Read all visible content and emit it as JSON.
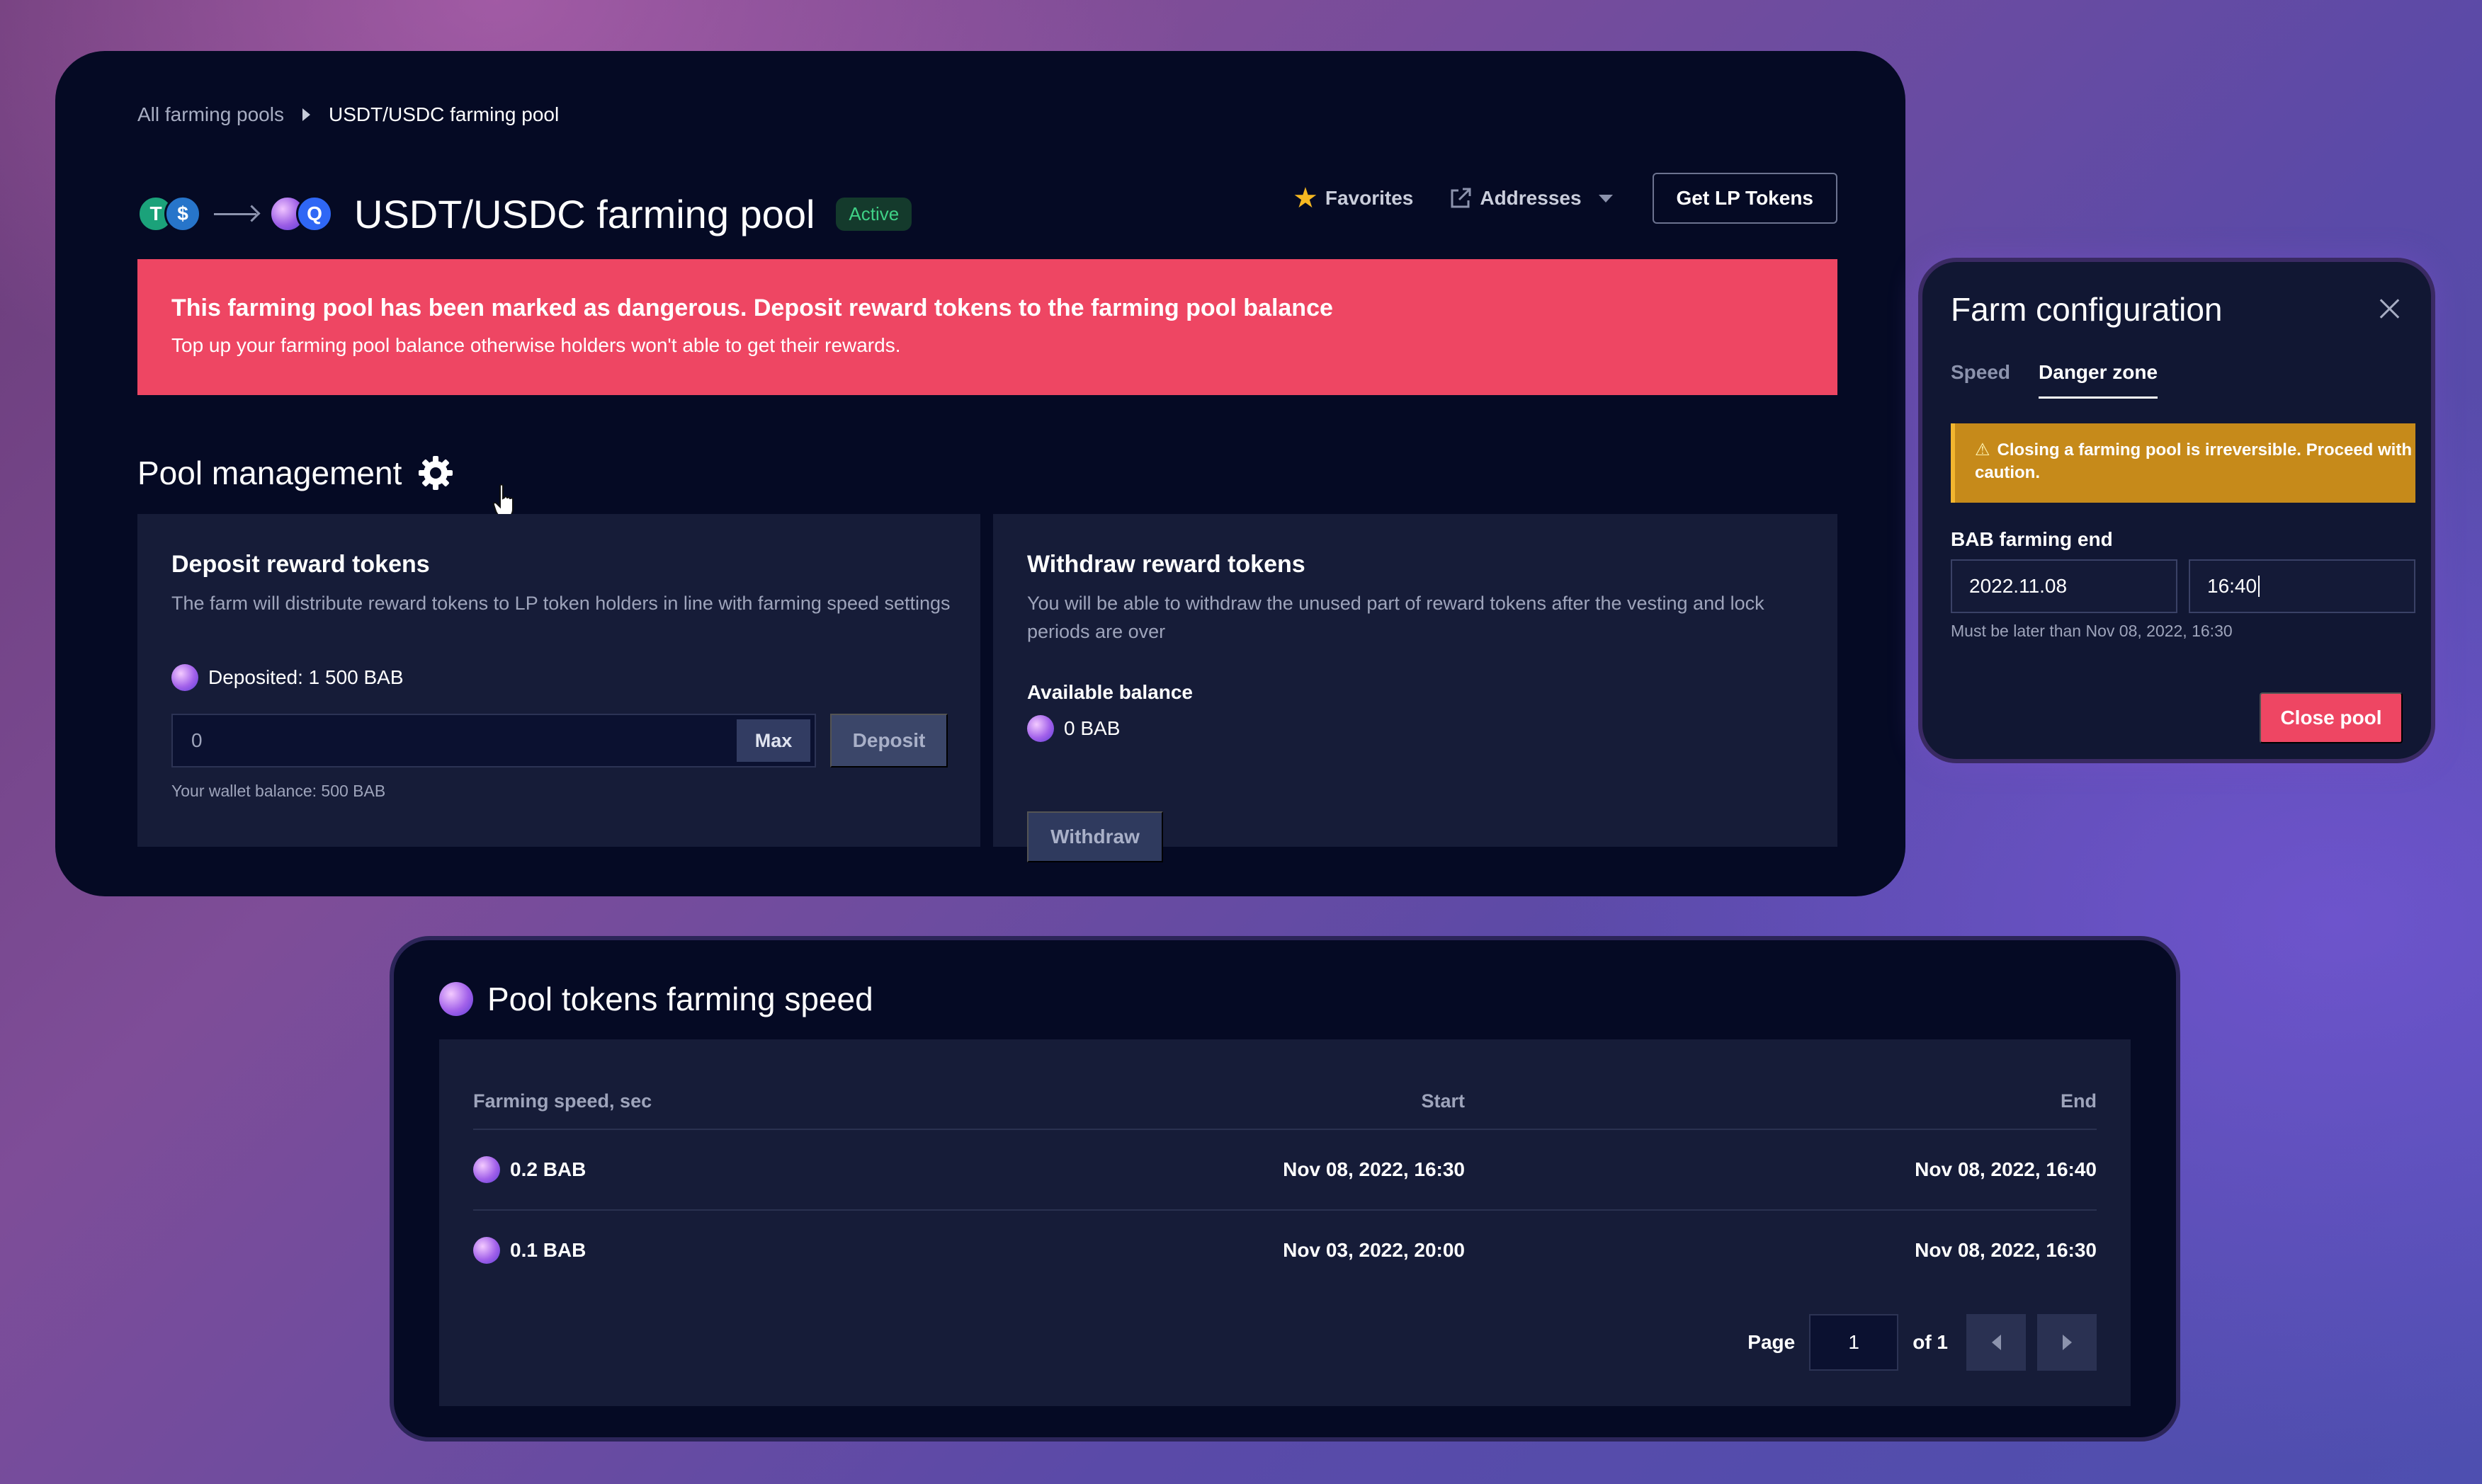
{
  "breadcrumb": {
    "parent": "All farming pools",
    "current": "USDT/USDC farming pool"
  },
  "header": {
    "token_a_icon": "usdt-icon",
    "token_b_icon": "usdc-icon",
    "title": "USDT/USDC farming pool",
    "status": "Active",
    "favorites_label": "Favorites",
    "addresses_label": "Addresses",
    "get_lp_label": "Get LP Tokens"
  },
  "alert": {
    "title": "This farming pool has been marked as dangerous. Deposit reward tokens to the farming pool balance",
    "subtitle": "Top up your farming pool balance otherwise holders won't able to get their rewards."
  },
  "management": {
    "title": "Pool management",
    "deposit": {
      "title": "Deposit reward tokens",
      "description": "The farm will distribute reward tokens to LP token holders in line with farming speed settings",
      "deposited": "Deposited: 1 500 BAB",
      "input_value": "0",
      "max_label": "Max",
      "deposit_label": "Deposit",
      "wallet_balance": "Your wallet balance: 500 BAB"
    },
    "withdraw": {
      "title": "Withdraw reward tokens",
      "description": "You will be able to withdraw the unused part of reward tokens after the vesting and lock periods are over",
      "available_label": "Available balance",
      "available_value": "0 BAB",
      "withdraw_label": "Withdraw"
    }
  },
  "config": {
    "title": "Farm configuration",
    "tabs": [
      {
        "label": "Speed"
      },
      {
        "label": "Danger zone"
      }
    ],
    "active_tab": "Danger zone",
    "warning": "Closing a farming pool is irreversible. Proceed with caution.",
    "end_label": "BAB farming end",
    "date_value": "2022.11.08",
    "time_value": "16:40",
    "hint": "Must be later than Nov 08, 2022, 16:30",
    "close_label": "Close pool"
  },
  "speed": {
    "title": "Pool tokens farming speed",
    "columns": [
      "Farming speed, sec",
      "Start",
      "End"
    ],
    "rows": [
      {
        "speed": "0.2 BAB",
        "start": "Nov 08, 2022, 16:30",
        "end": "Nov 08, 2022, 16:40"
      },
      {
        "speed": "0.1 BAB",
        "start": "Nov 03, 2022, 20:00",
        "end": "Nov 08, 2022, 16:30"
      }
    ],
    "pager": {
      "page_label": "Page",
      "page_value": "1",
      "of_label": "of 1"
    }
  },
  "colors": {
    "danger": "#ee4663",
    "warning": "#c68a1a",
    "active_text": "#3fd186",
    "panel_bg": "#050a24",
    "card_bg": "#161c38"
  }
}
